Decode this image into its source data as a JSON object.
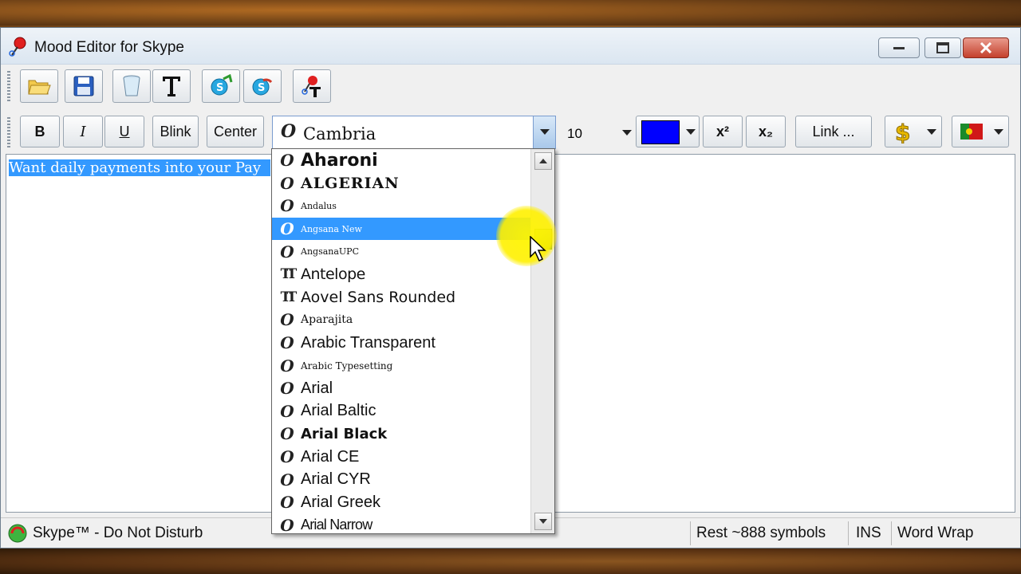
{
  "window": {
    "title": "Mood Editor for Skype"
  },
  "toolbar_main": {
    "buttons": [
      {
        "name": "open-button",
        "icon": "folder-open-icon"
      },
      {
        "name": "save-button",
        "icon": "floppy-disk-icon"
      },
      {
        "name": "clear-button",
        "icon": "recycle-bin-icon"
      },
      {
        "name": "text-button",
        "icon": "text-t-icon"
      },
      {
        "name": "skype-link-button",
        "icon": "skype-globe-icon"
      },
      {
        "name": "skype-refresh-button",
        "icon": "skype-arrow-icon"
      },
      {
        "name": "mood-text-button",
        "icon": "pin-t-icon"
      }
    ]
  },
  "toolbar_format": {
    "bold": "B",
    "italic": "I",
    "underline": "U",
    "blink": "Blink",
    "center": "Center",
    "font_value": "Cambria",
    "size_value": "10",
    "color": "#0000ff",
    "link": "Link ...",
    "superscript": "x²",
    "subscript": "x₂"
  },
  "editor": {
    "text": "Want daily payments into your Pay"
  },
  "font_dropdown": {
    "items": [
      {
        "label": "Aharoni",
        "type": "otf"
      },
      {
        "label": "ALGERIAN",
        "type": "otf"
      },
      {
        "label": "Andalus",
        "type": "otf"
      },
      {
        "label": "Angsana New",
        "type": "otf",
        "selected": true
      },
      {
        "label": "AngsanaUPC",
        "type": "otf"
      },
      {
        "label": "Antelope",
        "type": "ttf"
      },
      {
        "label": "Aovel Sans Rounded",
        "type": "ttf"
      },
      {
        "label": "Aparajita",
        "type": "otf"
      },
      {
        "label": "Arabic Transparent",
        "type": "otf"
      },
      {
        "label": "Arabic Typesetting",
        "type": "otf"
      },
      {
        "label": "Arial",
        "type": "otf"
      },
      {
        "label": "Arial Baltic",
        "type": "otf"
      },
      {
        "label": "Arial Black",
        "type": "otf"
      },
      {
        "label": "Arial CE",
        "type": "otf"
      },
      {
        "label": "Arial CYR",
        "type": "otf"
      },
      {
        "label": "Arial Greek",
        "type": "otf"
      },
      {
        "label": "Arial Narrow",
        "type": "otf"
      }
    ]
  },
  "status": {
    "skype": "Skype™ - Do Not Disturb",
    "rest": "Rest ~888 symbols",
    "mode": "INS",
    "wrap": "Word Wrap"
  },
  "colors": {
    "selection": "#3399ff",
    "highlight": "#fff000",
    "scroll_thumb": "#8bc34a"
  }
}
